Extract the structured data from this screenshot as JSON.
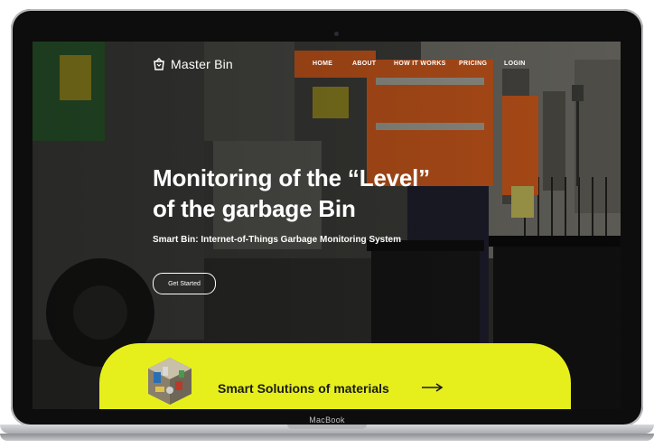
{
  "device": {
    "label": "MacBook"
  },
  "nav": {
    "brand": "Master Bin",
    "brand_icon": "bin-icon",
    "links": [
      "HOME",
      "ABOUT",
      "HOW IT WORKS",
      "PRICING",
      "LOGIN"
    ]
  },
  "hero": {
    "title_line1": "Monitoring of the “Level”",
    "title_line2": "of the garbage Bin",
    "subtitle": "Smart Bin: Internet-of-Things Garbage Monitoring System",
    "cta_label": "Get Started"
  },
  "promo": {
    "text": "Smart Solutions of materials",
    "arrow_icon": "arrow-right-icon",
    "background": "#e6ef1c"
  }
}
